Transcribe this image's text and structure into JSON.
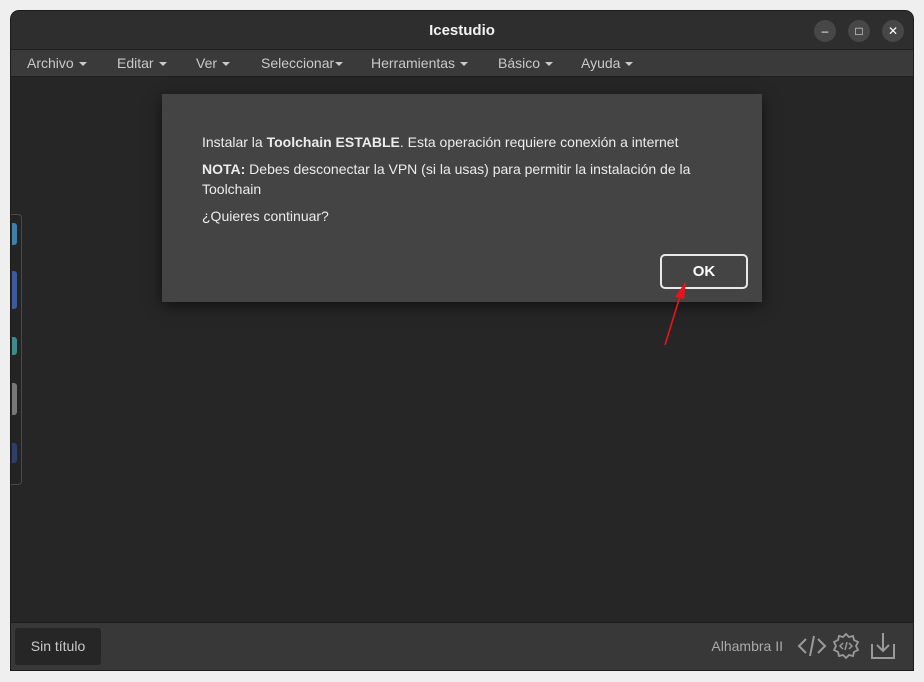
{
  "window": {
    "title": "Icestudio",
    "controls": {
      "minimize": "–",
      "maximize": "□",
      "close": "✕"
    }
  },
  "menu": {
    "items": [
      {
        "label": "Archivo"
      },
      {
        "label": "Editar"
      },
      {
        "label": "Ver"
      },
      {
        "label": "Seleccionar"
      },
      {
        "label": "Herramientas"
      },
      {
        "label": "Básico"
      },
      {
        "label": "Ayuda"
      }
    ]
  },
  "dialog": {
    "line1_prefix": "Instalar la ",
    "line1_bold": "Toolchain ESTABLE",
    "line1_suffix": ". Esta operación requiere conexión a internet",
    "line2_bold": "NOTA:",
    "line2_text": " Debes desconectar la VPN (si la usas) para permitir la instalación de la Toolchain",
    "line3": "¿Quieres continuar?",
    "ok_label": "OK"
  },
  "statusbar": {
    "file_tab": "Sin título",
    "board": "Alhambra II",
    "icons": [
      "code-icon",
      "settings-code-icon",
      "download-icon"
    ]
  },
  "colors": {
    "arrow": "#e8141c",
    "background": "#262626",
    "dialog": "#444444"
  }
}
